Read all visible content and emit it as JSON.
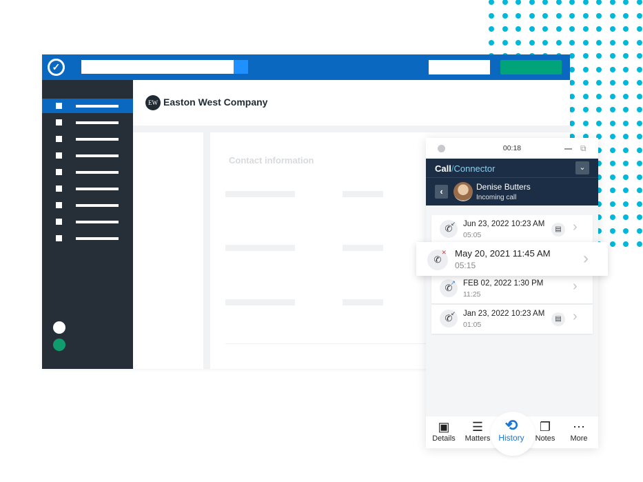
{
  "colors": {
    "topbar": "#0a68c0",
    "sidebar": "#262f37",
    "accent_green": "#00a37a",
    "dots": "#00b8d9",
    "panel_header": "#1b2e45",
    "history_blue": "#1976d2"
  },
  "app": {
    "company_logo_initials": "EW",
    "company_name": "Easton West Company",
    "section_title": "Contact information"
  },
  "call": {
    "timer": "00:18",
    "brand_call": "Call",
    "brand_slash": "/",
    "brand_connector": "Connector",
    "contact_name": "Denise Butters",
    "contact_status": "Incoming call",
    "history": [
      {
        "date": "Jun 23, 2022 10:23 AM",
        "duration": "05:05",
        "type": "incoming",
        "icon": "phone-incoming-icon",
        "has_note": true
      },
      {
        "date": "May 20, 2021 11:45 AM",
        "duration": "05:15",
        "type": "missed",
        "icon": "phone-missed-icon",
        "has_note": false
      },
      {
        "date": "FEB 02, 2022 1:30 PM",
        "duration": "11:25",
        "type": "outgoing",
        "icon": "phone-outgoing-icon",
        "has_note": false
      },
      {
        "date": "Jan 23, 2022 10:23 AM",
        "duration": "01:05",
        "type": "incoming",
        "icon": "phone-incoming-icon",
        "has_note": true
      }
    ],
    "nav": [
      {
        "label": "Details"
      },
      {
        "label": "Matters"
      },
      {
        "label": "History",
        "active": true
      },
      {
        "label": "Notes"
      },
      {
        "label": "More"
      }
    ]
  }
}
